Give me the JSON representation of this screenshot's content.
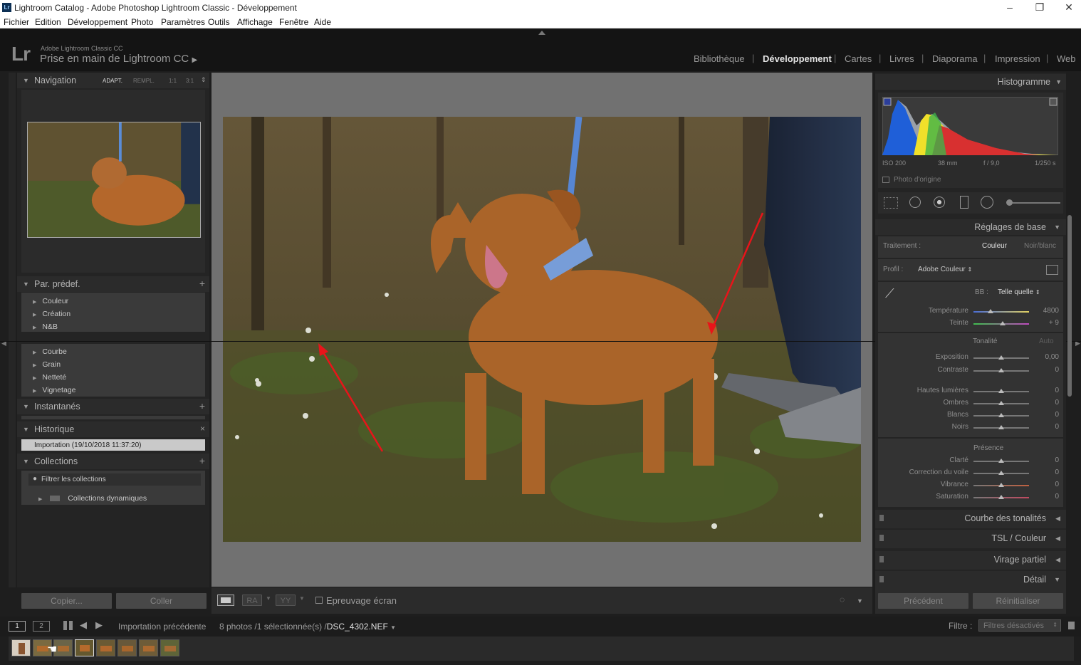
{
  "window": {
    "title": "Lightroom Catalog - Adobe Photoshop Lightroom Classic - Développement",
    "app_icon": "Lr",
    "controls": [
      "–",
      "❐",
      "✕"
    ]
  },
  "menu": [
    "Fichier",
    "Edition",
    "Développement",
    "Photo",
    "Paramètres",
    "Outils",
    "Affichage",
    "Fenêtre",
    "Aide"
  ],
  "identity": {
    "logo": "Lr",
    "product": "Adobe Lightroom Classic CC",
    "catalog": "Prise en main de Lightroom CC",
    "catalog_arrow": "▶"
  },
  "modules": [
    "Bibliothèque",
    "Développement",
    "Cartes",
    "Livres",
    "Diaporama",
    "Impression",
    "Web"
  ],
  "active_module": "Développement",
  "left": {
    "navigation": {
      "label": "Navigation",
      "zoom": [
        "ADAPT.",
        "REMPL.",
        "1:1",
        "3:1"
      ],
      "zoom_arrow": "⇕"
    },
    "presets": {
      "label": "Par. prédef.",
      "group1": [
        "Couleur",
        "Création",
        "N&B"
      ],
      "group2": [
        "Courbe",
        "Grain",
        "Netteté",
        "Vignetage"
      ]
    },
    "snapshots": {
      "label": "Instantanés"
    },
    "history": {
      "label": "Historique",
      "entry": "Importation (19/10/2018 11:37:20)",
      "clear": "×"
    },
    "collections": {
      "label": "Collections",
      "filter": "Filtrer les collections",
      "smart": "Collections dynamiques"
    },
    "copy_button": "Copier...",
    "paste_button": "Coller"
  },
  "toolbar": {
    "soft_proof": "Epreuvage écran",
    "ra": "RA",
    "yy": "YY"
  },
  "right": {
    "histogram": {
      "label": "Histogramme",
      "iso": "ISO 200",
      "focal": "38 mm",
      "aperture": "f / 9,0",
      "shutter": "1/250 s",
      "original": "Photo d'origine"
    },
    "basic": {
      "label": "Réglages de base",
      "treatment_label": "Traitement :",
      "treatment_color": "Couleur",
      "treatment_bw": "Noir/blanc",
      "profile_label": "Profil :",
      "profile_value": "Adobe Couleur",
      "wb_label": "BB :",
      "wb_value": "Telle quelle",
      "tone_label": "Tonalité",
      "auto": "Auto",
      "presence_label": "Présence",
      "sliders": [
        {
          "name": "Température",
          "value": "4800",
          "pos": 0.31
        },
        {
          "name": "Teinte",
          "value": "+ 9",
          "pos": 0.53
        },
        {
          "name": "Exposition",
          "value": "0,00",
          "pos": 0.5
        },
        {
          "name": "Contraste",
          "value": "0",
          "pos": 0.5
        },
        {
          "name": "Hautes lumières",
          "value": "0",
          "pos": 0.5
        },
        {
          "name": "Ombres",
          "value": "0",
          "pos": 0.5
        },
        {
          "name": "Blancs",
          "value": "0",
          "pos": 0.5
        },
        {
          "name": "Noirs",
          "value": "0",
          "pos": 0.5
        },
        {
          "name": "Clarté",
          "value": "0",
          "pos": 0.5
        },
        {
          "name": "Correction du voile",
          "value": "0",
          "pos": 0.5
        },
        {
          "name": "Vibrance",
          "value": "0",
          "pos": 0.5
        },
        {
          "name": "Saturation",
          "value": "0",
          "pos": 0.5
        }
      ]
    },
    "collapsed": [
      "Courbe des tonalités",
      "TSL / Couleur",
      "Virage partiel",
      "Détail"
    ],
    "prev_button": "Précédent",
    "reset_button": "Réinitialiser"
  },
  "filmstrip": {
    "screen1": "1",
    "screen2": "2",
    "source": "Importation précédente",
    "count": "8 photos /1 sélectionnée(s) /",
    "filename": "DSC_4302.NEF",
    "filter_label": "Filtre :",
    "filter_value": "Filtres désactivés"
  },
  "colors": {
    "accent": "#e6e6e6",
    "panel": "#2b2b2b",
    "arrow": "#e8141a"
  }
}
